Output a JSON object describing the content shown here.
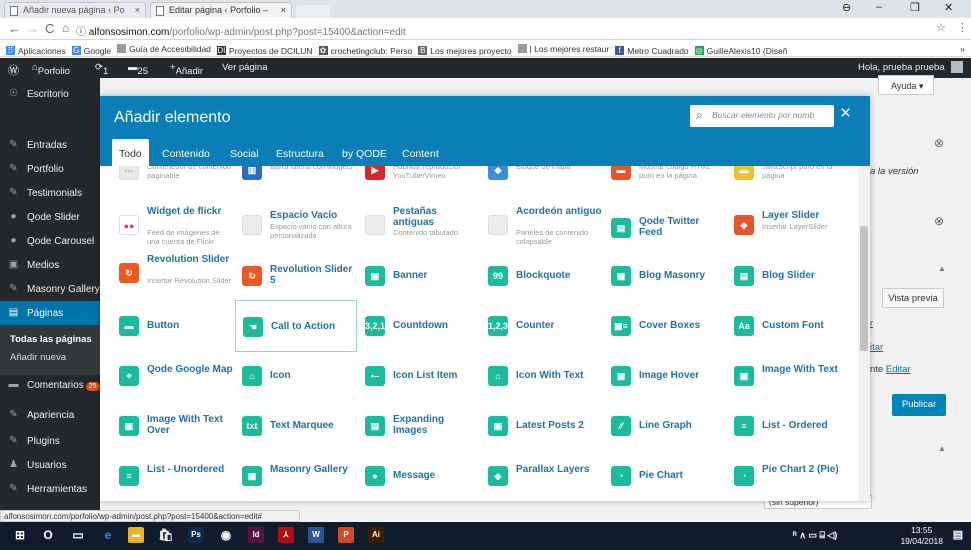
{
  "browser": {
    "tabs": [
      {
        "label": "Añadir nueva página ‹ Po",
        "close": "×"
      },
      {
        "label": "Editar página ‹ Porfolio –",
        "close": "×"
      }
    ],
    "url_host": "alfonsosimon.com",
    "url_path": "/porfolio/wp-admin/post.php?post=15400&action=edit",
    "bookmarks": [
      {
        "label": "Aplicaciones",
        "color": "#4a8af4",
        "glyph": "⠿"
      },
      {
        "label": "Google",
        "color": "#4285f4",
        "glyph": "G"
      },
      {
        "label": "Guía de Accesibilidad",
        "color": "#999999",
        "glyph": ""
      },
      {
        "label": "Proyectos de DCILUN",
        "color": "#333333",
        "glyph": "DI"
      },
      {
        "label": "crochetingclub: Perso",
        "color": "#555555",
        "glyph": "✿"
      },
      {
        "label": "Los mejores proyecto",
        "color": "#666666",
        "glyph": "B"
      },
      {
        "label": "| Los mejores restaur",
        "color": "#999999",
        "glyph": ""
      },
      {
        "label": "Metro Cuadrado",
        "color": "#3b5998",
        "glyph": "f"
      },
      {
        "label": "GuilleAlexis10 (Diseñ",
        "color": "#25a25a",
        "glyph": "◎"
      }
    ],
    "bookmarks_more": "»",
    "status_url": "alfonsosimon.com/porfolio/wp-admin/post.php?post=15400&action=edit#"
  },
  "adminbar": {
    "site": "Porfolio",
    "updates": "1",
    "comments": "25",
    "add": "Añadir",
    "view": "Ver página",
    "greeting": "Hola, prueba prueba"
  },
  "sidebar": {
    "items": [
      {
        "label": "Escritorio",
        "icon": "☉"
      },
      {
        "label": "Entradas",
        "icon": "✎"
      },
      {
        "label": "Portfolio",
        "icon": "✎"
      },
      {
        "label": "Testimonials",
        "icon": "✎"
      },
      {
        "label": "Qode Slider",
        "icon": "●"
      },
      {
        "label": "Qode Carousel",
        "icon": "●"
      },
      {
        "label": "Medios",
        "icon": "▣"
      },
      {
        "label": "Masonry Gallery",
        "icon": "✎"
      },
      {
        "label": "Páginas",
        "icon": "▤"
      }
    ],
    "submenu": [
      "Todas las páginas",
      "Añadir nueva"
    ],
    "lower": [
      {
        "label": "Comentarios",
        "icon": "▬",
        "badge": "25"
      },
      {
        "label": "Apariencia",
        "icon": "✎"
      },
      {
        "label": "Plugins",
        "icon": "✎"
      },
      {
        "label": "Usuarios",
        "icon": "♟"
      },
      {
        "label": "Herramientas",
        "icon": "✎"
      }
    ]
  },
  "right_panel": {
    "help": "Ayuda ▾",
    "version_text": "a la versión",
    "preview": "Vista previa",
    "edit_link_1": "r",
    "edit_link_2": "itar",
    "editar_prefix": "nte ",
    "editar": "Editar",
    "publish": "Publicar",
    "dropdown": "(sin superior)"
  },
  "modal": {
    "title": "Añadir elemento",
    "search_placeholder": "Buscar elemento por nomb",
    "close": "×",
    "tabs": [
      "Todo",
      "Contenido",
      "Social",
      "Estructura",
      "by QODE",
      "Content"
    ],
    "elements": [
      [
        {
          "t": "",
          "d": "Contenedor de contenido paginable",
          "c": "#e8e8e8",
          "g": "···"
        },
        {
          "t": "",
          "d": "Barra lateral con widgets",
          "c": "#2a6fb8",
          "g": "▥"
        },
        {
          "t": "",
          "d": "Habilitar reproductor YouTube/Vimeo",
          "c": "#d9262b",
          "g": "▶"
        },
        {
          "t": "",
          "d": "Bloque de mapa",
          "c": "#3a8fd4",
          "g": "◆"
        },
        {
          "t": "",
          "d": "Mostrar código HTML puro en la página",
          "c": "#e8542b",
          "g": "▬"
        },
        {
          "t": "",
          "d": "JavaScript puro en la página",
          "c": "#f0c12f",
          "g": "▬"
        }
      ],
      [
        {
          "t": "Widget de flickr",
          "d": "Feed de imágenes de una cuenta de Flickr",
          "c": "#ffffff",
          "g": "●●"
        },
        {
          "t": "Espacio Vacío",
          "d": "Espacio vacío con altura personalizada",
          "c": "#ececec",
          "g": ""
        },
        {
          "t": "Pestañas antiguas",
          "d": "Contenido tabulado",
          "c": "#ececec",
          "g": ""
        },
        {
          "t": "Acordeón antiguo",
          "d": "Paneles de contenido colapsable",
          "c": "#ececec",
          "g": ""
        },
        {
          "t": "Qode Twitter Feed",
          "d": "",
          "c": "#1abc9c",
          "g": "▤"
        },
        {
          "t": "Layer Slider",
          "d": "Insertar LayerSlider",
          "c": "#e8542b",
          "g": "◈"
        }
      ],
      [
        {
          "t": "Revolution Slider",
          "d": "Insertar Revolution Slider",
          "c": "#ef5a24",
          "g": "↻"
        },
        {
          "t": "Revolution Slider 5",
          "d": "",
          "c": "#ef5a24",
          "g": "↻"
        },
        {
          "t": "Banner",
          "d": "",
          "c": "#1abc9c",
          "g": "▣"
        },
        {
          "t": "Blockquote",
          "d": "",
          "c": "#1abc9c",
          "g": "99"
        },
        {
          "t": "Blog Masonry",
          "d": "",
          "c": "#1abc9c",
          "g": "▦"
        },
        {
          "t": "Blog Slider",
          "d": "",
          "c": "#1abc9c",
          "g": "▤"
        }
      ],
      [
        {
          "t": "Button",
          "d": "",
          "c": "#1abc9c",
          "g": "▬"
        },
        {
          "t": "Call to Action",
          "d": "",
          "c": "#1abc9c",
          "g": "☚"
        },
        {
          "t": "Countdown",
          "d": "",
          "c": "#1abc9c",
          "g": "3,2,1"
        },
        {
          "t": "Counter",
          "d": "",
          "c": "#1abc9c",
          "g": "1,2,3"
        },
        {
          "t": "Cover Boxes",
          "d": "",
          "c": "#1abc9c",
          "g": "▣≡"
        },
        {
          "t": "Custom Font",
          "d": "",
          "c": "#1abc9c",
          "g": "Aa"
        }
      ],
      [
        {
          "t": "Qode Google Map",
          "d": "",
          "c": "#1abc9c",
          "g": "⌖"
        },
        {
          "t": "Icon",
          "d": "",
          "c": "#1abc9c",
          "g": "⌂"
        },
        {
          "t": "Icon List Item",
          "d": "",
          "c": "#1abc9c",
          "g": "•–"
        },
        {
          "t": "Icon With Text",
          "d": "",
          "c": "#1abc9c",
          "g": "⌂"
        },
        {
          "t": "Image Hover",
          "d": "",
          "c": "#1abc9c",
          "g": "▣"
        },
        {
          "t": "Image With Text",
          "d": "",
          "c": "#1abc9c",
          "g": "▣"
        }
      ],
      [
        {
          "t": "Image With Text Over",
          "d": "",
          "c": "#1abc9c",
          "g": "▣"
        },
        {
          "t": "Text Marquee",
          "d": "",
          "c": "#1abc9c",
          "g": "txt"
        },
        {
          "t": "Expanding Images",
          "d": "",
          "c": "#1abc9c",
          "g": "▤"
        },
        {
          "t": "Latest Posts 2",
          "d": "",
          "c": "#1abc9c",
          "g": "▣"
        },
        {
          "t": "Line Graph",
          "d": "",
          "c": "#1abc9c",
          "g": "⁄⁄"
        },
        {
          "t": "List - Ordered",
          "d": "",
          "c": "#1abc9c",
          "g": "≡"
        }
      ],
      [
        {
          "t": "List - Unordered",
          "d": "",
          "c": "#1abc9c",
          "g": "≡"
        },
        {
          "t": "Masonry Gallery",
          "d": "",
          "c": "#1abc9c",
          "g": "▦"
        },
        {
          "t": "Message",
          "d": "",
          "c": "#1abc9c",
          "g": "●"
        },
        {
          "t": "Parallax Layers",
          "d": "",
          "c": "#1abc9c",
          "g": "◈"
        },
        {
          "t": "Pie Chart",
          "d": "",
          "c": "#1abc9c",
          "g": "◔"
        },
        {
          "t": "Pie Chart 2 (Pie)",
          "d": "",
          "c": "#1abc9c",
          "g": "◔"
        }
      ]
    ]
  },
  "taskbar": {
    "apps": [
      {
        "g": "O",
        "c": "transparent"
      },
      {
        "g": "▭",
        "c": "transparent"
      },
      {
        "g": "e",
        "c": "transparent"
      },
      {
        "g": "▬",
        "c": "#e8b22a"
      },
      {
        "g": "🛍",
        "c": "transparent"
      },
      {
        "g": "Ps",
        "c": "#0f2a46"
      },
      {
        "g": "◉",
        "c": "transparent"
      },
      {
        "g": "Id",
        "c": "#5c1143"
      },
      {
        "g": "⅄",
        "c": "#b10f0f"
      },
      {
        "g": "W",
        "c": "#2b579a"
      },
      {
        "g": "P",
        "c": "#d24726"
      },
      {
        "g": "Ai",
        "c": "#3c1e00"
      }
    ],
    "time": "13:55",
    "date": "19/04/2018"
  }
}
